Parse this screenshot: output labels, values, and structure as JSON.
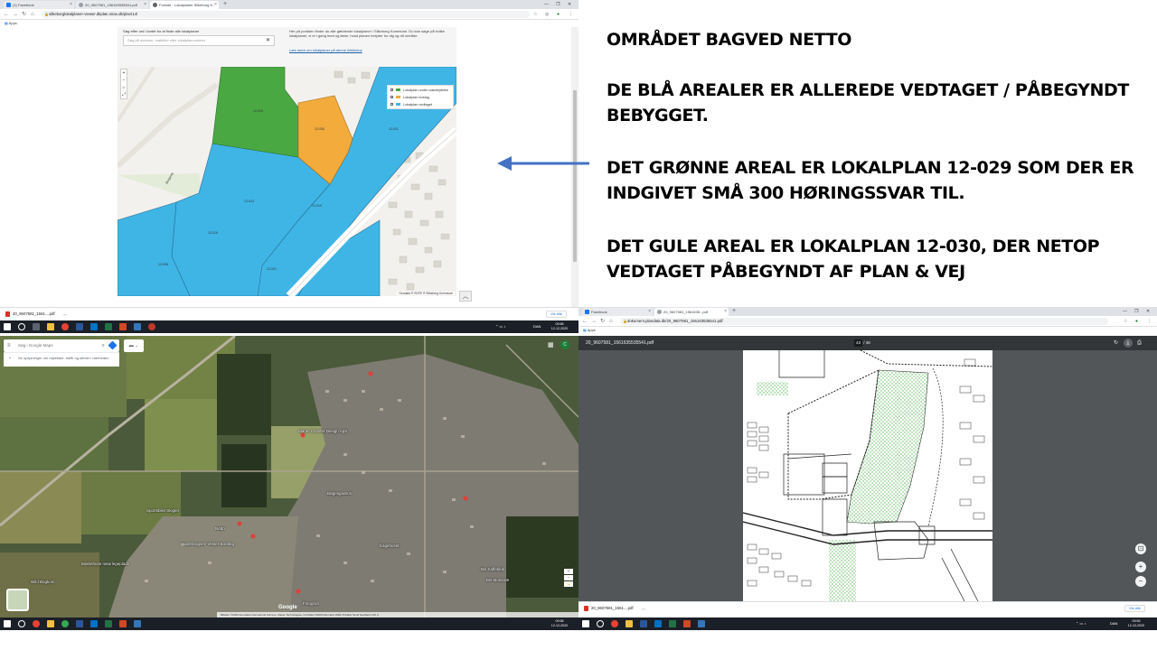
{
  "notes": {
    "line1": "OMRÅDET BAGVED NETTO",
    "line2a": "DE BLÅ AREALER ER ALLEREDE VEDTAGET / PÅBEGYNDT",
    "line2b": "BEBYGGET.",
    "line3a": "DET GRØNNE AREAL ER LOKALPLAN 12-029 SOM DER ER",
    "line3b": "INDGIVET SMÅ 300 HØRINGSSVAR TIL.",
    "line4a": "DET GULE AREAL ER LOKALPLAN 12-030, DER NETOP",
    "line4b": "VEDTAGET PÅBEGYNDT AF PLAN & VEJ"
  },
  "colors": {
    "accent_arrow": "#4472c4",
    "lokalplan_vedtaget": "#3fb5e6",
    "lokalplan_forslag": "#f3ab3c",
    "lokalplan_under_udarbejdelse": "#4aa843"
  },
  "browser1": {
    "tabs": [
      {
        "label": "(1) Facebook",
        "icon": "facebook-icon"
      },
      {
        "label": "20_9607581_156163535541.pdf",
        "icon": "globe-icon"
      },
      {
        "label": "Forside - Lokalplaner Silkeborg K...",
        "icon": "globe-icon"
      }
    ],
    "url": "silkeborglokalplaner-viewer.dkplan.niras.dk/plan/14/",
    "bookmarks_label": "Apps",
    "search_label": "Søg efter ord i kortet for at finde alle lokalplaner",
    "search_placeholder": "Søg på adresse, matrikler eller lokalplannummer",
    "header_text": "Her på portalen finder du alle gældende lokalplaner i Silkeborg Kommune. Du kan søge på hvilke lokalplaner, vi er i gang med og læse, hvad planen betyder for dig og dit område.",
    "header_link": "Læs mere om lokalplaner på denne Webinfos",
    "legend": [
      {
        "label": "Lokalplan under udarbejdelse",
        "color": "#4aa843"
      },
      {
        "label": "Lokalplan forslag",
        "color": "#f3ab3c"
      },
      {
        "label": "Lokalplan vedtaget",
        "color": "#3fb5e6"
      }
    ],
    "attribution": "Geodata ® SDFE ® Silkeborg Kommune",
    "parcel_labels": [
      "12-029",
      "12-030",
      "12-011",
      "12-013",
      "12-019",
      "12-016",
      "12-006",
      "12-021"
    ],
    "road_label": "Borgevej",
    "download_file": "20_9607581_1561....pdf",
    "show_all": "Vis alle"
  },
  "taskbar1": {
    "time": "09:58",
    "date": "12-12-2020",
    "lang": "DAN"
  },
  "gmaps": {
    "search_placeholder": "Søg i Google Maps",
    "hint": "Se oplysninger om rejsetider, trafik og steder i nærheden",
    "labels": [
      "Martin Christer Design ApS",
      "Netto",
      "Bis Kaffeklok",
      "Superbrugsen Vester Bording",
      "Bøgesgade 5",
      "Fotografi",
      "Wild Bogkom",
      "Sportsbiks Skigen",
      "Bakkehuse naturlegeplads",
      "Kagehuset",
      "Bis Moestræ"
    ],
    "footer": "Billeder ©2020 Aerodata International Surveys, Maxar Technologies, Kortdata ©2020   Danmark   Vilkår   Privatliv   Send feedback   100 m",
    "google_label": "Google"
  },
  "taskbar2": {
    "time": "09:55",
    "date": "12-12-2020",
    "lang": "DAN"
  },
  "browser2": {
    "tabs": [
      {
        "label": "Facebook",
        "icon": "facebook-icon"
      },
      {
        "label": "20_9607581_1561635...pdf",
        "icon": "globe-icon"
      }
    ],
    "url": "dokument.plandata.dk/20_9607581_156163535541.pdf",
    "bookmarks_label": "Apps",
    "pdf_title": "20_9607581_1561635535541.pdf",
    "page_current": "43",
    "page_total": "46",
    "download_file": "20_9607581_1561....pdf",
    "show_all": "Vis alle"
  }
}
